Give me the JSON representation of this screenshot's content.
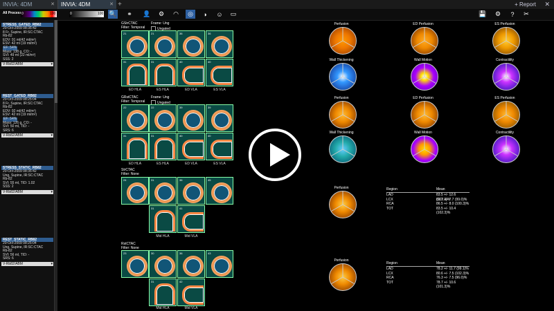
{
  "tabs": [
    {
      "label": "INVIA: 4DM"
    },
    {
      "label": "INVIA: 4DM"
    }
  ],
  "tab_add": "+",
  "report_label": "+ Report",
  "close_label": "✕",
  "toolbar": {
    "processing": "All Processing",
    "cbar_min": "0",
    "cbar_max": "100",
    "gbar_min": "0",
    "gbar_max": "100"
  },
  "studies": [
    {
      "title": "STRESS_GATED_RB82",
      "lines": [
        "20-Oct-2009 08:35:42",
        "8 Fr, Supine, IR:SC:CTAC",
        "Rb-82",
        "EDV: 91 ml(42 ml/m²)",
        "ESV: 42 ml (19 ml/m²)"
      ],
      "hl": "EF: 54%",
      "lines2": [
        "Mass: 138 g, CO: -",
        "SVI: 49 ml (22 ml/m²)",
        "SSS: 2"
      ],
      "select": "V-Rb82/ABM"
    },
    {
      "title": "REST_GATED_RB82",
      "lines": [
        "20-Oct-2009 08:25:04",
        "8 Fr, Supine, IR:SC:CTAC",
        "Rb-82",
        "EDV: 92 ml(42 ml/m²)",
        "ESV: 42 ml (19 ml/m²)"
      ],
      "hl": "EF: 54%",
      "lines2": [
        "Mass: 126 g, CO: -",
        "SVI: 50 ml, TID: -",
        "SRS: 6"
      ],
      "select": "V-Rb82/ABM"
    },
    {
      "title": "STRESS_STATIC_RB82",
      "lines": [
        "20-Oct-2009 08:35:42",
        "Ung, Supine, IR:SC:CTAC",
        "Rb-82",
        "SVI: 55 ml, TID: 1.02",
        "SSS: 2"
      ],
      "hl": "",
      "lines2": [],
      "select": "V-Rb82/ABM"
    },
    {
      "title": "REST_STATIC_RB82",
      "lines": [
        "20-Oct-2009 08:25:04",
        "Ung, Supine, IR:SC:CTAC",
        "Rb-82",
        "SVI: 56 ml, TID: -",
        "SRS: 6"
      ],
      "hl": "",
      "lines2": [],
      "select": "V-Rb82/ABM"
    }
  ],
  "groups": [
    {
      "title": "GStrCTAC",
      "filter": "Filter: Temporal",
      "frame": "Frame: Ung",
      "ungated": "Ungated",
      "labels": [
        "ED HLA",
        "ES HLA",
        "ED VLA",
        "ES VLA"
      ]
    },
    {
      "title": "GRstCTAC",
      "filter": "Filter: Temporal",
      "frame": "Frame: Ung",
      "ungated": "Ungated",
      "labels": [
        "ED HLA",
        "ES HLA",
        "ED VLA",
        "ES VLA"
      ]
    },
    {
      "title": "StrCTAC",
      "filter": "Filter: None",
      "labels": [
        "Mid HLA",
        "Mid VLA"
      ]
    },
    {
      "title": "RstCTAC",
      "filter": "Filter: None",
      "labels": [
        "Mid HLA",
        "Mid VLA"
      ]
    }
  ],
  "polar_labels": {
    "row1": [
      "Perfusion",
      "ED Perfusion",
      "ES Perfusion"
    ],
    "row2": [
      "Wall Thickening",
      "Wall Motion",
      "Contractility"
    ],
    "row3": [
      "Perfusion",
      "ED Perfusion",
      "ES Perfusion"
    ],
    "row4": [
      "Wall Thickening",
      "Wall Motion",
      "Contractility"
    ],
    "row5": [
      "Perfusion"
    ],
    "row6": [
      "Perfusion"
    ]
  },
  "tables": [
    {
      "h1": "Region",
      "h2": "Mean",
      "rows": [
        [
          "LAD",
          "83.5 +/- 12.6 (102.3)%"
        ],
        [
          "LCX",
          "81.7 +/- 7.7 (99.0)%"
        ],
        [
          "RCA",
          "86.5 +/- 8.0 (100.3)%"
        ],
        [
          "TOT",
          "83.5 +/- 10.4 (102.3)%"
        ]
      ]
    },
    {
      "h1": "Region",
      "h2": "Mean",
      "rows": [
        [
          "LAD",
          "78.2 +/- 11.7 (99.1)%"
        ],
        [
          "LCX",
          "80.6 +/- 7.5 (102.3)%"
        ],
        [
          "RCA",
          "76.3 +/- 7.5 (96.0)%"
        ],
        [
          "TOT",
          "78.7 +/- 10.6 (101.3)%"
        ]
      ]
    }
  ],
  "colors": {
    "accent": "#2e5c8f",
    "tile_bg": "#0a4a44"
  }
}
